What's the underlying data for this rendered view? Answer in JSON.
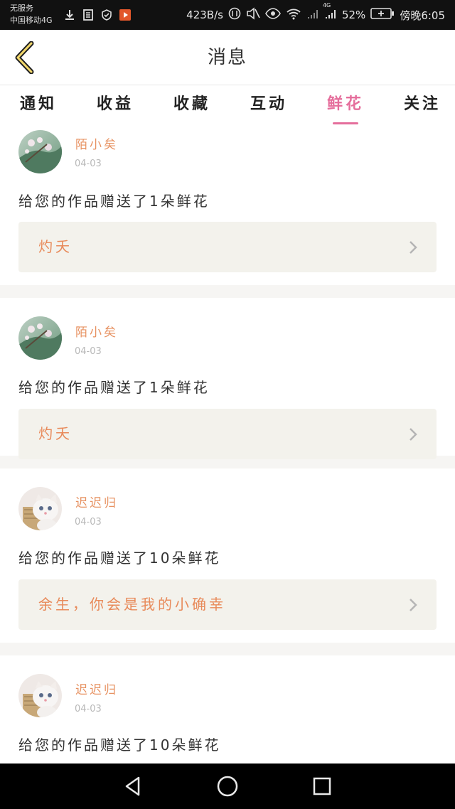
{
  "status_bar": {
    "carrier_line1": "无服务",
    "carrier_line2": "中国移动4G",
    "net_speed": "423B/s",
    "battery_pct": "52%",
    "network_label": "4G",
    "time": "傍晚6:05",
    "icons": [
      "download-icon",
      "sim-icon",
      "vpn-icon",
      "video-app-icon",
      "data-icon",
      "mute-icon",
      "eye-icon",
      "wifi-icon",
      "signal-icon",
      "battery-icon"
    ]
  },
  "header": {
    "back_icon": "back-chevron-icon",
    "title": "消息"
  },
  "tabs": [
    {
      "label": "通知",
      "active": false
    },
    {
      "label": "收益",
      "active": false
    },
    {
      "label": "收藏",
      "active": false
    },
    {
      "label": "互动",
      "active": false
    },
    {
      "label": "鲜花",
      "active": true
    },
    {
      "label": "关注",
      "active": false
    }
  ],
  "notifications": [
    {
      "username": "陌小矣",
      "date": "04-03",
      "message": "给您的作品赠送了1朵鲜花",
      "work_title": "灼夭",
      "avatar": "blossom-avatar"
    },
    {
      "username": "陌小矣",
      "date": "04-03",
      "message": "给您的作品赠送了1朵鲜花",
      "work_title": "灼夭",
      "avatar": "blossom-avatar"
    },
    {
      "username": "迟迟归",
      "date": "04-03",
      "message": "给您的作品赠送了10朵鲜花",
      "work_title": "余生，你会是我的小确幸",
      "avatar": "kitten-avatar"
    },
    {
      "username": "迟迟归",
      "date": "04-03",
      "message": "给您的作品赠送了10朵鲜花",
      "work_title": "",
      "avatar": "kitten-avatar"
    }
  ],
  "colors": {
    "accent_pink": "#e56e9c",
    "username_orange": "#e79262",
    "work_title_orange": "#e88a5a",
    "work_box_bg": "#f3f2ec"
  },
  "nav_bar": {
    "icons": [
      "back-triangle-icon",
      "home-circle-icon",
      "recents-square-icon"
    ]
  }
}
